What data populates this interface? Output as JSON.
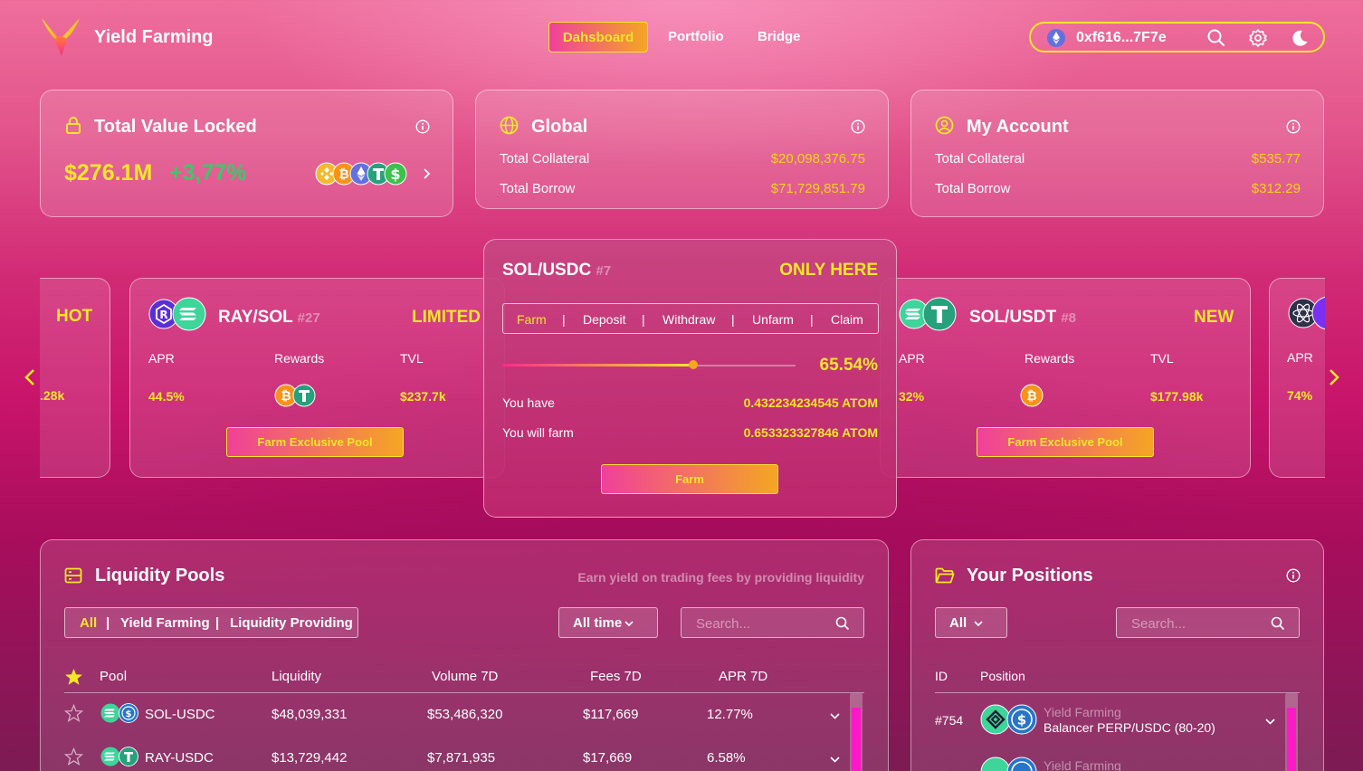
{
  "header": {
    "brand": "Yield Farming",
    "nav": [
      "Dahsboard",
      "Portfolio",
      "Bridge"
    ],
    "wallet_address": "0xf616...7F7e"
  },
  "tvl_card": {
    "title": "Total Value Locked",
    "value": "$276.1M",
    "change": "+3,77%"
  },
  "global_card": {
    "title": "Global",
    "rows": [
      {
        "label": "Total Collateral",
        "value": "$20,098,376.75"
      },
      {
        "label": "Total Borrow",
        "value": "$71,729,851.79"
      }
    ]
  },
  "account_card": {
    "title": "My Account",
    "rows": [
      {
        "label": "Total Collateral",
        "value": "$535.77"
      },
      {
        "label": "Total Borrow",
        "value": "$312.29"
      }
    ]
  },
  "carousel": {
    "left_partial": {
      "tag": "HOT",
      "tvl": ".28k"
    },
    "ray_sol": {
      "pair": "RAY/SOL",
      "id": "#27",
      "tag": "LIMITED",
      "apr_label": "APR",
      "rewards_label": "Rewards",
      "tvl_label": "TVL",
      "apr": "44.5%",
      "tvl": "$237.7k",
      "button": "Farm Exclusive Pool"
    },
    "sol_usdt": {
      "pair": "SOL/USDT",
      "id": "#8",
      "tag": "NEW",
      "apr_label": "APR",
      "rewards_label": "Rewards",
      "tvl_label": "TVL",
      "apr": "32%",
      "tvl": "$177.98k",
      "button": "Farm Exclusive Pool"
    },
    "right_partial": {
      "apr_label": "APR",
      "apr": "74%"
    }
  },
  "modal": {
    "pair": "SOL/USDC",
    "id": "#7",
    "tag": "ONLY HERE",
    "tabs": [
      "Farm",
      "Deposit",
      "Withdraw",
      "Unfarm",
      "Claim"
    ],
    "tab_sep": "|",
    "percent_label": "65.54%",
    "slider_fraction": 0.65,
    "you_have_label": "You have",
    "you_have_value": "0.432234234545 ATOM",
    "will_farm_label": "You will farm",
    "will_farm_value": "0.653323327846 ATOM",
    "button": "Farm"
  },
  "liquidity": {
    "title": "Liquidity Pools",
    "subtitle": "Earn yield on trading fees by providing liquidity",
    "filters": [
      "All",
      "Yield Farming",
      "Liquidity Providing"
    ],
    "filter_sep": "|",
    "time_select": "All time",
    "search_placeholder": "Search...",
    "columns": [
      "Pool",
      "Liquidity",
      "Volume 7D",
      "Fees 7D",
      "APR 7D"
    ],
    "rows": [
      {
        "pool": "SOL-USDC",
        "liquidity": "$48,039,331",
        "volume": "$53,486,320",
        "fees": "$117,669",
        "apr": "12.77%"
      },
      {
        "pool": "RAY-USDC",
        "liquidity": "$13,729,442",
        "volume": "$7,871,935",
        "fees": "$17,669",
        "apr": "6.58%"
      }
    ]
  },
  "positions": {
    "title": "Your Positions",
    "filter_select": "All",
    "search_placeholder": "Search...",
    "columns": [
      "ID",
      "Position"
    ],
    "rows": [
      {
        "id": "#754",
        "type": "Yield Farming",
        "name": "Balancer PERP/USDC (80-20)"
      },
      {
        "id": "",
        "type": "Yield Farming",
        "name": ""
      }
    ]
  },
  "colors": {
    "accent_yellow": "#f5e62a",
    "value_gold": "#f3d21c",
    "green": "#39c96a",
    "scroll_pink": "#ff18c8"
  }
}
